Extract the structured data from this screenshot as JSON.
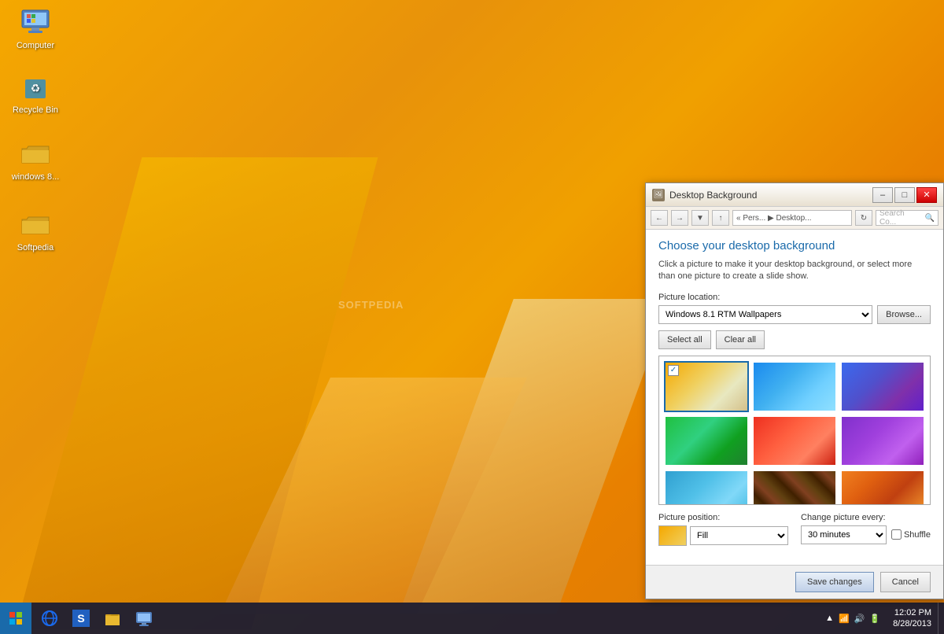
{
  "desktop": {
    "icons": [
      {
        "id": "computer",
        "label": "Computer",
        "type": "computer"
      },
      {
        "id": "recycle",
        "label": "Recycle Bin",
        "type": "recycle"
      },
      {
        "id": "windows8",
        "label": "windows 8...",
        "type": "folder"
      },
      {
        "id": "softpedia",
        "label": "Softpedia",
        "type": "folder"
      }
    ],
    "watermark": "SOFTPEDIA"
  },
  "taskbar": {
    "items": [
      "ie",
      "skydrive",
      "explorer",
      "rdp"
    ],
    "clock_time": "12:02 PM",
    "clock_date": "8/28/2013"
  },
  "dialog": {
    "title": "Desktop Background",
    "icon": "🖼",
    "main_title": "Choose your desktop background",
    "subtitle": "Click a picture to make it your desktop background, or select more than one picture to create a slide show.",
    "picture_location_label": "Picture location:",
    "picture_location_value": "Windows 8.1 RTM Wallpapers",
    "browse_label": "Browse...",
    "select_all_label": "Select all",
    "clear_all_label": "Clear all",
    "address_bar_text": "« Pers... ▶ Desktop...",
    "search_placeholder": "Search Co...",
    "picture_position_label": "Picture position:",
    "position_value": "Fill",
    "change_every_label": "Change picture every:",
    "change_every_value": "30 minutes",
    "shuffle_label": "Shuffle",
    "save_label": "Save changes",
    "cancel_label": "Cancel",
    "wallpapers": [
      {
        "id": 1,
        "class": "wp-1",
        "selected": true
      },
      {
        "id": 2,
        "class": "wp-2",
        "selected": false
      },
      {
        "id": 3,
        "class": "wp-3",
        "selected": false
      },
      {
        "id": 4,
        "class": "wp-4",
        "selected": false
      },
      {
        "id": 5,
        "class": "wp-5",
        "selected": false
      },
      {
        "id": 6,
        "class": "wp-6",
        "selected": false
      },
      {
        "id": 7,
        "class": "wp-7",
        "selected": false
      },
      {
        "id": 8,
        "class": "wp-8",
        "selected": false
      },
      {
        "id": 9,
        "class": "wp-9",
        "selected": false
      }
    ]
  }
}
